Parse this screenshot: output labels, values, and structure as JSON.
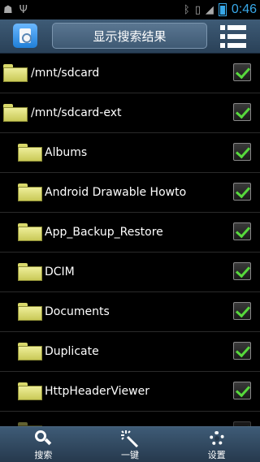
{
  "status_bar": {
    "time": "0:46",
    "left_icons": [
      "android-icon",
      "usb-icon"
    ],
    "right_icons": [
      "bluetooth-icon",
      "vibrate-icon",
      "signal-icon",
      "battery-icon"
    ]
  },
  "action_bar": {
    "title": "显示搜索结果",
    "app_icon": "file-search-icon",
    "menu_icon": "list-menu-icon"
  },
  "list": {
    "items": [
      {
        "label": "/mnt/sdcard",
        "checked": true
      },
      {
        "label": "/mnt/sdcard-ext",
        "checked": true
      },
      {
        "label": "Albums",
        "checked": true
      },
      {
        "label": "Android Drawable Howto",
        "checked": true
      },
      {
        "label": "App_Backup_Restore",
        "checked": true
      },
      {
        "label": "DCIM",
        "checked": true
      },
      {
        "label": "Documents",
        "checked": true
      },
      {
        "label": "Duplicate",
        "checked": true
      },
      {
        "label": "HttpHeaderViewer",
        "checked": true
      },
      {
        "label": "",
        "checked": true
      }
    ]
  },
  "bottom_bar": {
    "tabs": [
      {
        "label": "搜索",
        "icon": "search-icon"
      },
      {
        "label": "一键",
        "icon": "magic-wand-icon"
      },
      {
        "label": "设置",
        "icon": "gear-icon"
      }
    ]
  },
  "colors": {
    "accent": "#38a8e8",
    "bar": "#3e5b76",
    "check": "#57d93c",
    "folder": "#e3e37a"
  }
}
